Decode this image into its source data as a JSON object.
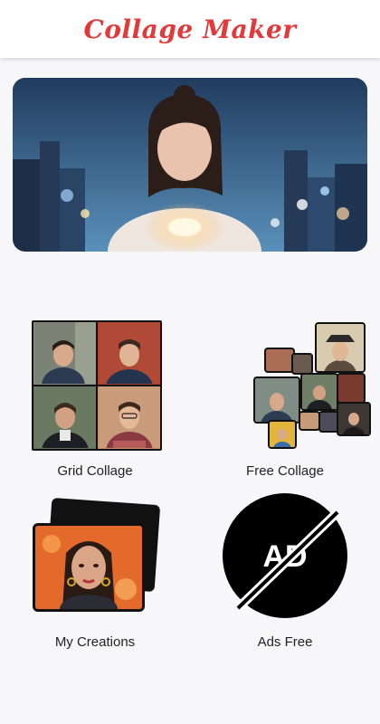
{
  "header": {
    "title": "Collage Maker"
  },
  "banner": {
    "image": "woman-city-lights-photo"
  },
  "tiles": {
    "grid": {
      "label": "Grid Collage",
      "icon": "grid-collage-icon"
    },
    "free": {
      "label": "Free Collage",
      "icon": "free-collage-icon"
    },
    "creations": {
      "label": "My Creations",
      "icon": "my-creations-icon"
    },
    "ads": {
      "label": "Ads Free",
      "icon": "ads-free-icon",
      "badge": "AD"
    }
  },
  "colors": {
    "title": "#e23a3a",
    "background": "#f7f7f9"
  }
}
